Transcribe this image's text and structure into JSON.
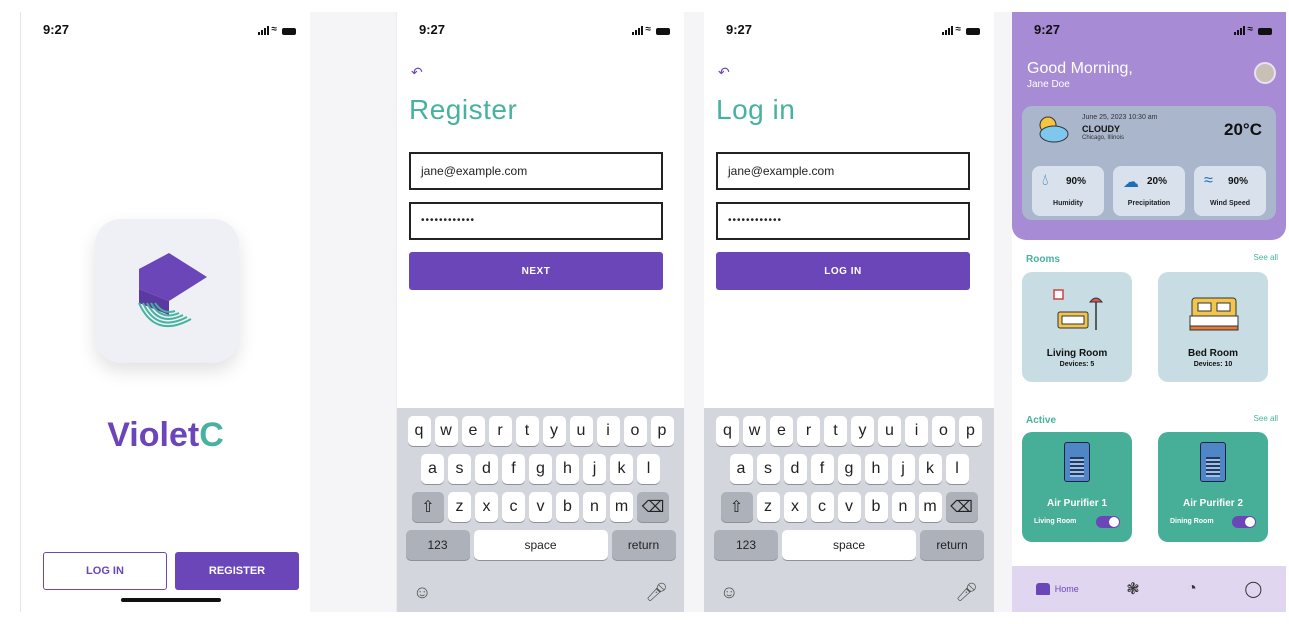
{
  "splash": {
    "status_time": "9:27",
    "brand_a": "Violet",
    "brand_b": "C",
    "login_label": "LOG IN",
    "register_label": "REGISTER"
  },
  "register": {
    "status_time": "9:27",
    "title": "Register",
    "email_value": "jane@example.com",
    "password_value": "••••••••••••",
    "next_label": "NEXT"
  },
  "login": {
    "status_time": "9:27",
    "title": "Log in",
    "email_value": "jane@example.com",
    "password_value": "••••••••••••",
    "login_label": "LOG IN"
  },
  "keyboard": {
    "row1": [
      "q",
      "w",
      "e",
      "r",
      "t",
      "y",
      "u",
      "i",
      "o",
      "p"
    ],
    "row2": [
      "a",
      "s",
      "d",
      "f",
      "g",
      "h",
      "j",
      "k",
      "l"
    ],
    "row3": [
      "z",
      "x",
      "c",
      "v",
      "b",
      "n",
      "m"
    ],
    "k123": "123",
    "space": "space",
    "return": "return"
  },
  "dashboard": {
    "status_time": "9:27",
    "greeting": "Good Morning,",
    "user_name": "Jane Doe",
    "weather": {
      "datetime": "June 25, 2023 10:30 am",
      "condition": "CLOUDY",
      "location": "Chicago, Illinois",
      "temperature": "20°C",
      "humidity_value": "90%",
      "humidity_label": "Humidity",
      "precip_value": "20%",
      "precip_label": "Precipitation",
      "wind_value": "90%",
      "wind_label": "Wind Speed"
    },
    "rooms_title": "Rooms",
    "see_all": "See all",
    "rooms": [
      {
        "name": "Living Room",
        "devices": "Devices: 5"
      },
      {
        "name": "Bed Room",
        "devices": "Devices: 10"
      }
    ],
    "active_title": "Active",
    "active": [
      {
        "name": "Air Purifier 1",
        "room": "Living Room"
      },
      {
        "name": "Air Purifier 2",
        "room": "Dining Room"
      }
    ],
    "nav_home": "Home"
  },
  "colors": {
    "violet": "#6b46b8",
    "teal": "#46b29f",
    "header_lavender": "#a78bd4"
  }
}
